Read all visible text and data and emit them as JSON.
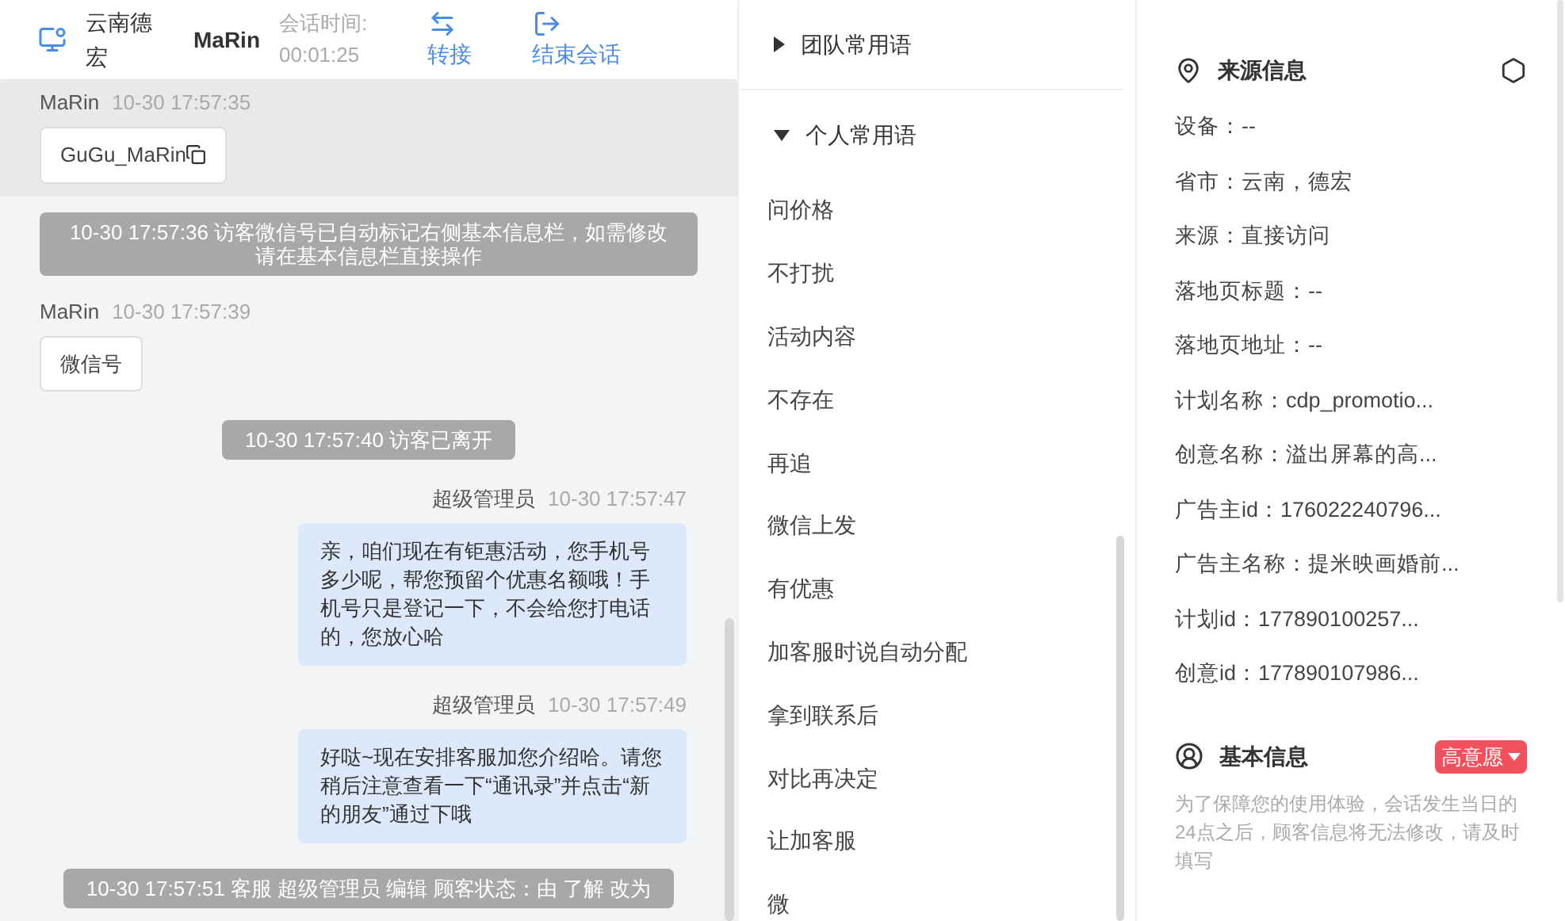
{
  "header": {
    "visitor_location": "云南德宏",
    "visitor_name": "MaRin",
    "duration_label": "会话时间:",
    "duration": "00:01:25",
    "actions": [
      {
        "kind": "transfer",
        "label": "转接"
      },
      {
        "kind": "end",
        "label": "结束会话"
      }
    ]
  },
  "messages": [
    {
      "kind": "visitor",
      "sender": "MaRin",
      "time": "10-30 17:57:35",
      "text": "GuGu_MaRin",
      "copyable": true,
      "highlighted": true
    },
    {
      "kind": "system",
      "text": "10-30 17:57:36 访客微信号已自动标记右侧基本信息栏，如需修改请在基本信息栏直接操作"
    },
    {
      "kind": "visitor",
      "sender": "MaRin",
      "time": "10-30 17:57:39",
      "text": "微信号",
      "copyable": false,
      "highlighted": false
    },
    {
      "kind": "system",
      "text": "10-30 17:57:40 访客已离开"
    },
    {
      "kind": "agent",
      "sender": "超级管理员",
      "time": "10-30 17:57:47",
      "text": "亲，咱们现在有钜惠活动，您手机号多少呢，帮您预留个优惠名额哦！手机号只是登记一下，不会给您打电话的，您放心哈"
    },
    {
      "kind": "agent",
      "sender": "超级管理员",
      "time": "10-30 17:57:49",
      "text": "好哒~现在安排客服加您介绍哈。请您稍后注意查看一下“通讯录”并点击“新的朋友”通过下哦"
    },
    {
      "kind": "system",
      "text": "10-30 17:57:51 客服 超级管理员 编辑 顾客状态：由 了解 改为"
    }
  ],
  "phrase_groups": [
    {
      "title": "团队常用语",
      "expanded": false
    },
    {
      "title": "个人常用语",
      "expanded": true,
      "items": [
        "问价格",
        "不打扰",
        "活动内容",
        "不存在",
        "再追",
        "微信上发",
        "有优惠",
        "加客服时说自动分配",
        "拿到联系后",
        "对比再决定",
        "让加客服",
        "微"
      ]
    }
  ],
  "source_info": {
    "title": "来源信息",
    "fields": [
      "设备：--",
      "省市：云南，德宏",
      "来源：直接访问",
      "落地页标题：--",
      "落地页地址：--",
      "计划名称：cdp_promotio...",
      "创意名称：溢出屏幕的高...",
      "广告主id：176022240796...",
      "广告主名称：提米映画婚前...",
      "计划id：177890100257...",
      "创意id：177890107986..."
    ]
  },
  "basic_info": {
    "title": "基本信息",
    "tag": "高意愿",
    "notice": "为了保障您的使用体验，会话发生当日的24点之后，顾客信息将无法修改，请及时填写"
  }
}
